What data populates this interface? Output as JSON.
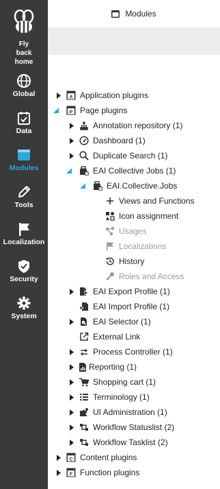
{
  "sidebar": {
    "logo_label": "Fly back home",
    "items": [
      {
        "label": "Global"
      },
      {
        "label": "Data"
      },
      {
        "label": "Modules"
      },
      {
        "label": "Tools"
      },
      {
        "label": "Localization"
      },
      {
        "label": "Security"
      },
      {
        "label": "System"
      }
    ],
    "active_color": "#2aa8e0"
  },
  "header": {
    "title": "Modules"
  },
  "tree": [
    {
      "label": "Application plugins"
    },
    {
      "label": "Page plugins"
    },
    {
      "label": "Annotation repository (1)"
    },
    {
      "label": "Dashboard (1)"
    },
    {
      "label": "Duplicate Search (1)"
    },
    {
      "label": "EAI Collective Jobs (1)"
    },
    {
      "label": "EAI.Collective.Jobs"
    },
    {
      "label": "Views and Functions"
    },
    {
      "label": "Icon assignment"
    },
    {
      "label": "Usages"
    },
    {
      "label": "Localizations"
    },
    {
      "label": "History"
    },
    {
      "label": "Roles and Access"
    },
    {
      "label": "EAI Export Profile (1)"
    },
    {
      "label": "EAI Import Profile (1)"
    },
    {
      "label": "EAI Selector (1)"
    },
    {
      "label": "External Link"
    },
    {
      "label": "Process Controller (1)"
    },
    {
      "label": "Reporting (1)"
    },
    {
      "label": "Shopping cart (1)"
    },
    {
      "label": "Terminology (1)"
    },
    {
      "label": "UI Administration (1)"
    },
    {
      "label": "Workflow Statuslist (2)"
    },
    {
      "label": "Workflow Tasklist (2)"
    },
    {
      "label": "Content plugins"
    },
    {
      "label": "Function plugins"
    }
  ]
}
